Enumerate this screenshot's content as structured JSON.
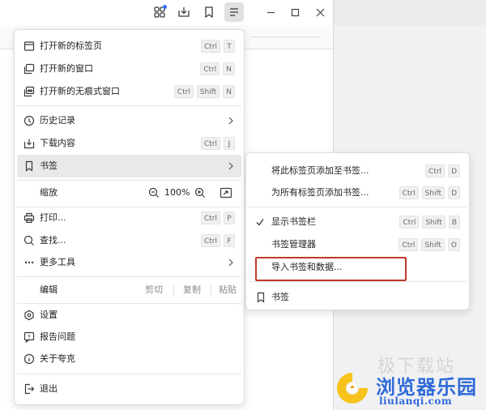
{
  "colors": {
    "accent": "#2f6df6",
    "highlight_box": "#c0392b",
    "watermark": "#2f6ad8",
    "logo_yellow": "#f7c21b"
  },
  "toolbar": {
    "icons": [
      "extensions-icon",
      "download-icon",
      "bookmark-icon",
      "menu-icon"
    ],
    "window_controls": [
      "minimize-icon",
      "maximize-icon",
      "close-icon"
    ]
  },
  "menu": {
    "new_tab": {
      "label": "打开新的标签页",
      "keys": [
        "Ctrl",
        "T"
      ]
    },
    "new_window": {
      "label": "打开新的窗口",
      "keys": [
        "Ctrl",
        "N"
      ]
    },
    "new_private": {
      "label": "打开新的无痕式窗口",
      "keys": [
        "Ctrl",
        "Shift",
        "N"
      ]
    },
    "history": {
      "label": "历史记录"
    },
    "downloads": {
      "label": "下载内容",
      "keys": [
        "Ctrl",
        "J"
      ]
    },
    "bookmarks": {
      "label": "书签"
    },
    "zoom": {
      "label": "缩放",
      "value": "100%"
    },
    "print": {
      "label": "打印...",
      "keys": [
        "Ctrl",
        "P"
      ]
    },
    "find": {
      "label": "查找...",
      "keys": [
        "Ctrl",
        "F"
      ]
    },
    "more_tools": {
      "label": "更多工具"
    },
    "edit": {
      "label": "编辑",
      "cut": "剪切",
      "copy": "复制",
      "paste": "粘贴"
    },
    "settings": {
      "label": "设置"
    },
    "report": {
      "label": "报告问题"
    },
    "about": {
      "label": "关于夸克"
    },
    "quit": {
      "label": "退出"
    }
  },
  "submenu": {
    "add_tab": {
      "label": "将此标签页添加至书签...",
      "keys": [
        "Ctrl",
        "D"
      ]
    },
    "add_all": {
      "label": "为所有标签页添加书签...",
      "keys": [
        "Ctrl",
        "Shift",
        "D"
      ]
    },
    "show_bar": {
      "label": "显示书签栏",
      "checked": true,
      "keys": [
        "Ctrl",
        "Shift",
        "B"
      ]
    },
    "manager": {
      "label": "书签管理器",
      "keys": [
        "Ctrl",
        "Shift",
        "O"
      ]
    },
    "import": {
      "label": "导入书签和数据..."
    },
    "bookmark": {
      "label": "书签"
    }
  },
  "watermark": {
    "faint": "极下载站",
    "title": "浏览器乐园",
    "url": "liulanqi.com"
  }
}
